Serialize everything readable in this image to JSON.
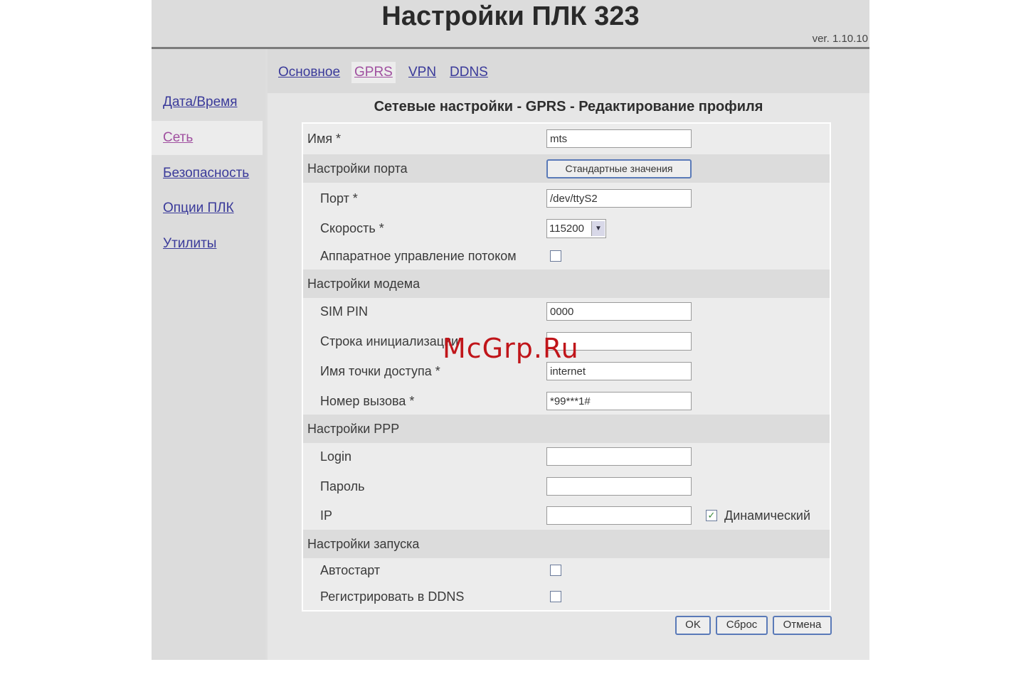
{
  "header": {
    "title": "Настройки ПЛК 323",
    "version": "ver. 1.10.10"
  },
  "sidebar": {
    "items": [
      {
        "label": "Дата/Время",
        "active": false
      },
      {
        "label": "Сеть",
        "active": true
      },
      {
        "label": "Безопасность",
        "active": false
      },
      {
        "label": "Опции ПЛК",
        "active": false
      },
      {
        "label": "Утилиты",
        "active": false
      }
    ]
  },
  "tabs": [
    {
      "label": "Основное",
      "active": false
    },
    {
      "label": "GPRS",
      "active": true
    },
    {
      "label": "VPN",
      "active": false
    },
    {
      "label": "DDNS",
      "active": false
    }
  ],
  "page_title": "Сетевые настройки - GPRS - Редактирование профиля",
  "form": {
    "name": {
      "label": "Имя *",
      "value": "mts"
    },
    "port_section": {
      "label": "Настройки порта",
      "button": "Стандартные значения"
    },
    "port": {
      "label": "Порт *",
      "value": "/dev/ttyS2"
    },
    "speed": {
      "label": "Скорость *",
      "value": "115200"
    },
    "flow_control": {
      "label": "Аппаратное управление потоком",
      "checked": false
    },
    "modem_section": {
      "label": "Настройки модема"
    },
    "sim_pin": {
      "label": "SIM PIN",
      "value": "0000"
    },
    "init_string": {
      "label": "Строка инициализации",
      "value": ""
    },
    "apn": {
      "label": "Имя точки доступа *",
      "value": "internet"
    },
    "dial_number": {
      "label": "Номер вызова *",
      "value": "*99***1#"
    },
    "ppp_section": {
      "label": "Настройки PPP"
    },
    "login": {
      "label": "Login",
      "value": ""
    },
    "password": {
      "label": "Пароль",
      "value": ""
    },
    "ip": {
      "label": "IP",
      "value": "",
      "dynamic_label": "Динамический",
      "dynamic_checked": true
    },
    "launch_section": {
      "label": "Настройки запуска"
    },
    "autostart": {
      "label": "Автостарт",
      "checked": false
    },
    "register_ddns": {
      "label": "Регистрировать в DDNS",
      "checked": false
    }
  },
  "buttons": {
    "ok": "OK",
    "reset": "Сброс",
    "cancel": "Отмена"
  },
  "watermark": "McGrp.Ru"
}
